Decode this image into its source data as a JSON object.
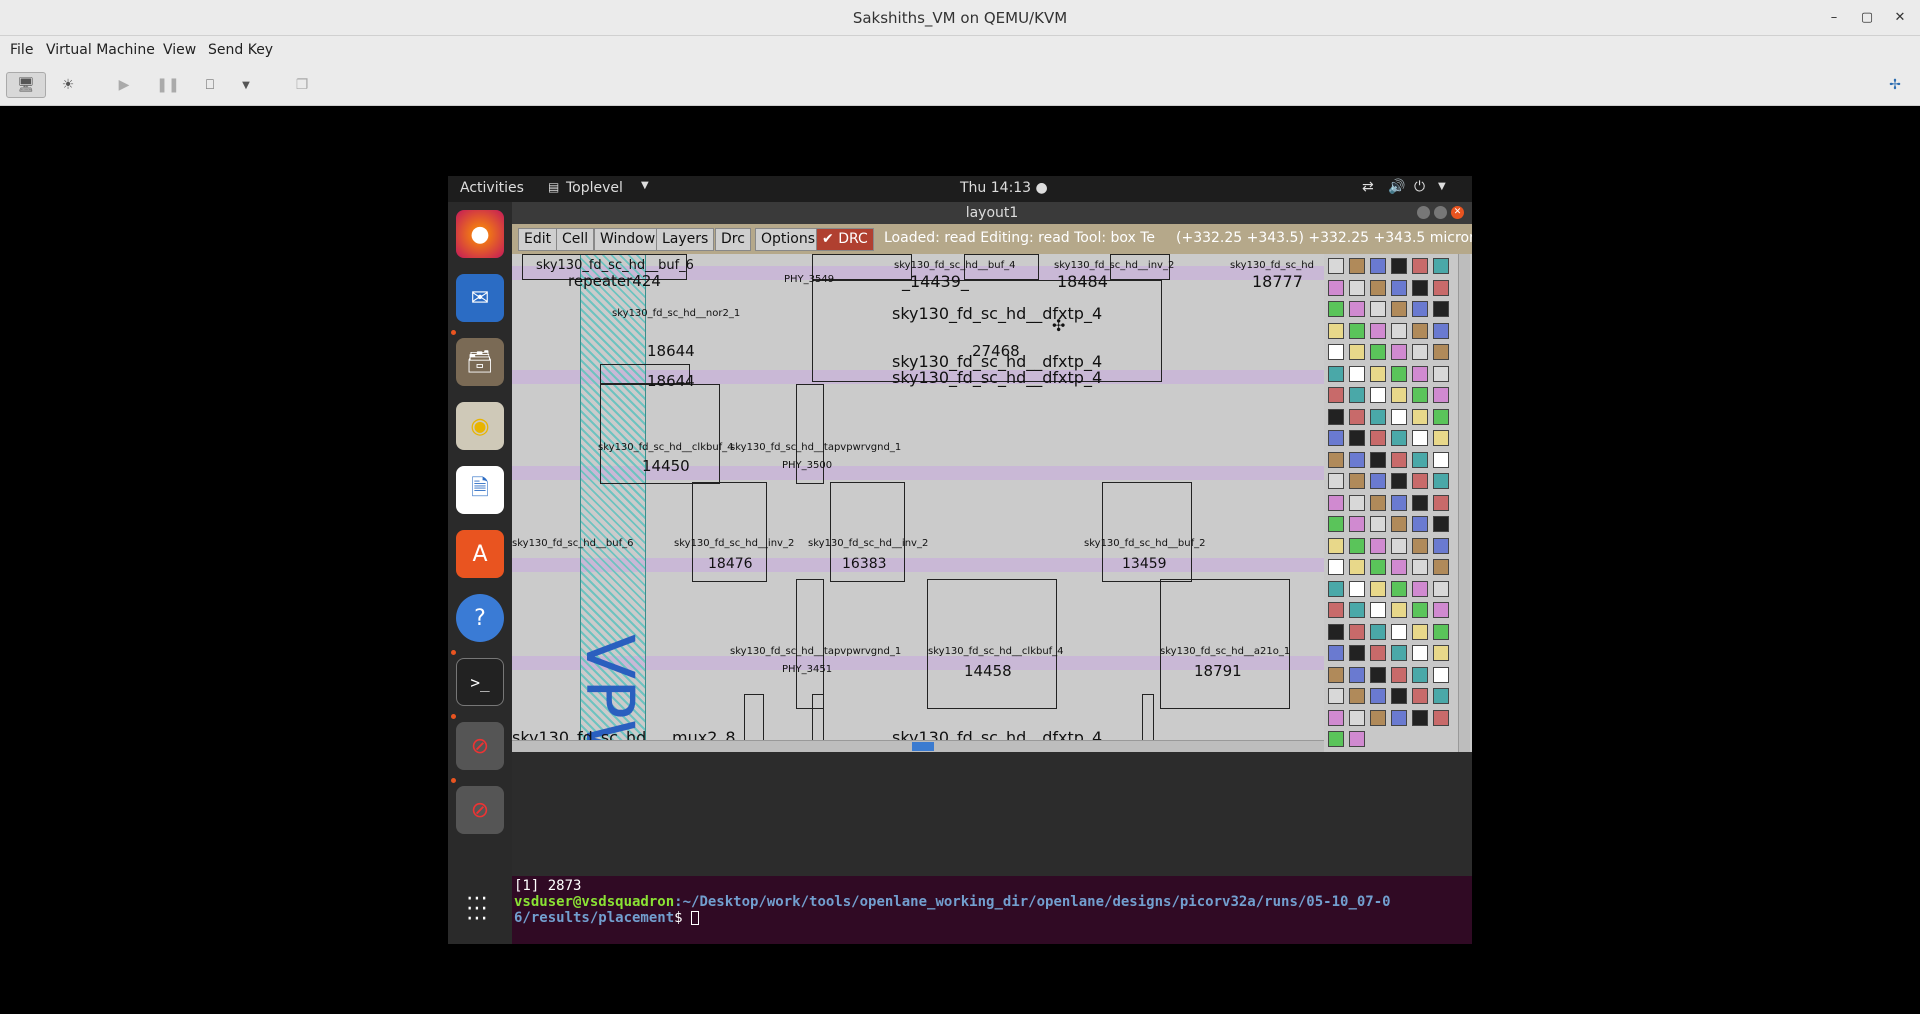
{
  "host": {
    "title": "Sakshiths_VM on QEMU/KVM",
    "menu": [
      "File",
      "Virtual Machine",
      "View",
      "Send Key"
    ]
  },
  "gnome": {
    "activities": "Activities",
    "app_menu": "Toplevel",
    "clock": "Thu 14:13 ●"
  },
  "magic": {
    "window_title": "layout1",
    "menu": [
      "Edit",
      "Cell",
      "Window",
      "Layers",
      "Drc",
      "Options"
    ],
    "drc_label": "DRC",
    "status": "Loaded: read Editing: read Tool: box  Te",
    "coords": "(+332.25 +343.5) +332.25 +343.5 microns"
  },
  "layout": {
    "vpwr_label": "VPWR",
    "cells": [
      "sky130_fd_sc_hd__buf_6",
      "repeater424",
      "PHY_3549",
      "sky130_fd_sc_hd__buf_4",
      "_14439_",
      "sky130_fd_sc_hd__inv_2",
      "18484",
      "sky130_fd_sc_hd",
      "18777",
      "sky130_fd_sc_hd__nor2_1",
      "sky130_fd_sc_hd__dfxtp_4",
      "18644",
      "27468",
      "sky130_fd_sc_hd__dfxtp_4",
      "sky130_fd_sc_hd__dfxtp_4",
      "18644",
      "sky130_fd_sc_hd__clkbuf_4",
      "sky130_fd_sc_hd__tapvpwrvgnd_1",
      "14450",
      "PHY_3500",
      "sky130_fd_sc_hd__buf_6",
      "sky130_fd_sc_hd__inv_2",
      "sky130_fd_sc_hd__inv_2",
      "sky130_fd_sc_hd__buf_2",
      "18476",
      "16383",
      "13459",
      "sky130_fd_sc_hd__tapvpwrvgnd_1",
      "sky130_fd_sc_hd__clkbuf_4",
      "sky130_fd_sc_hd__a21o_1",
      "PHY_3451",
      "14458",
      "18791",
      "sky130_fd_sc_hd",
      "mux2_8",
      "sky130_fd_sc_hd__dfxtp_4"
    ]
  },
  "terminal": {
    "line1": "[1] 2873",
    "prompt_user": "vsduser@vsdsquadron",
    "prompt_path": ":~/Desktop/work/tools/openlane_working_dir/openlane/designs/picorv32a/runs/05-10_07-0",
    "prompt_path2": "6/results/placement",
    "prompt_end": "$ "
  },
  "colors": {
    "rail": "#c9b8d6",
    "vpwr": "#2a5fbf",
    "terminal_bg": "#300a24",
    "prompt_user": "#8ae234",
    "prompt_path": "#729fcf"
  }
}
